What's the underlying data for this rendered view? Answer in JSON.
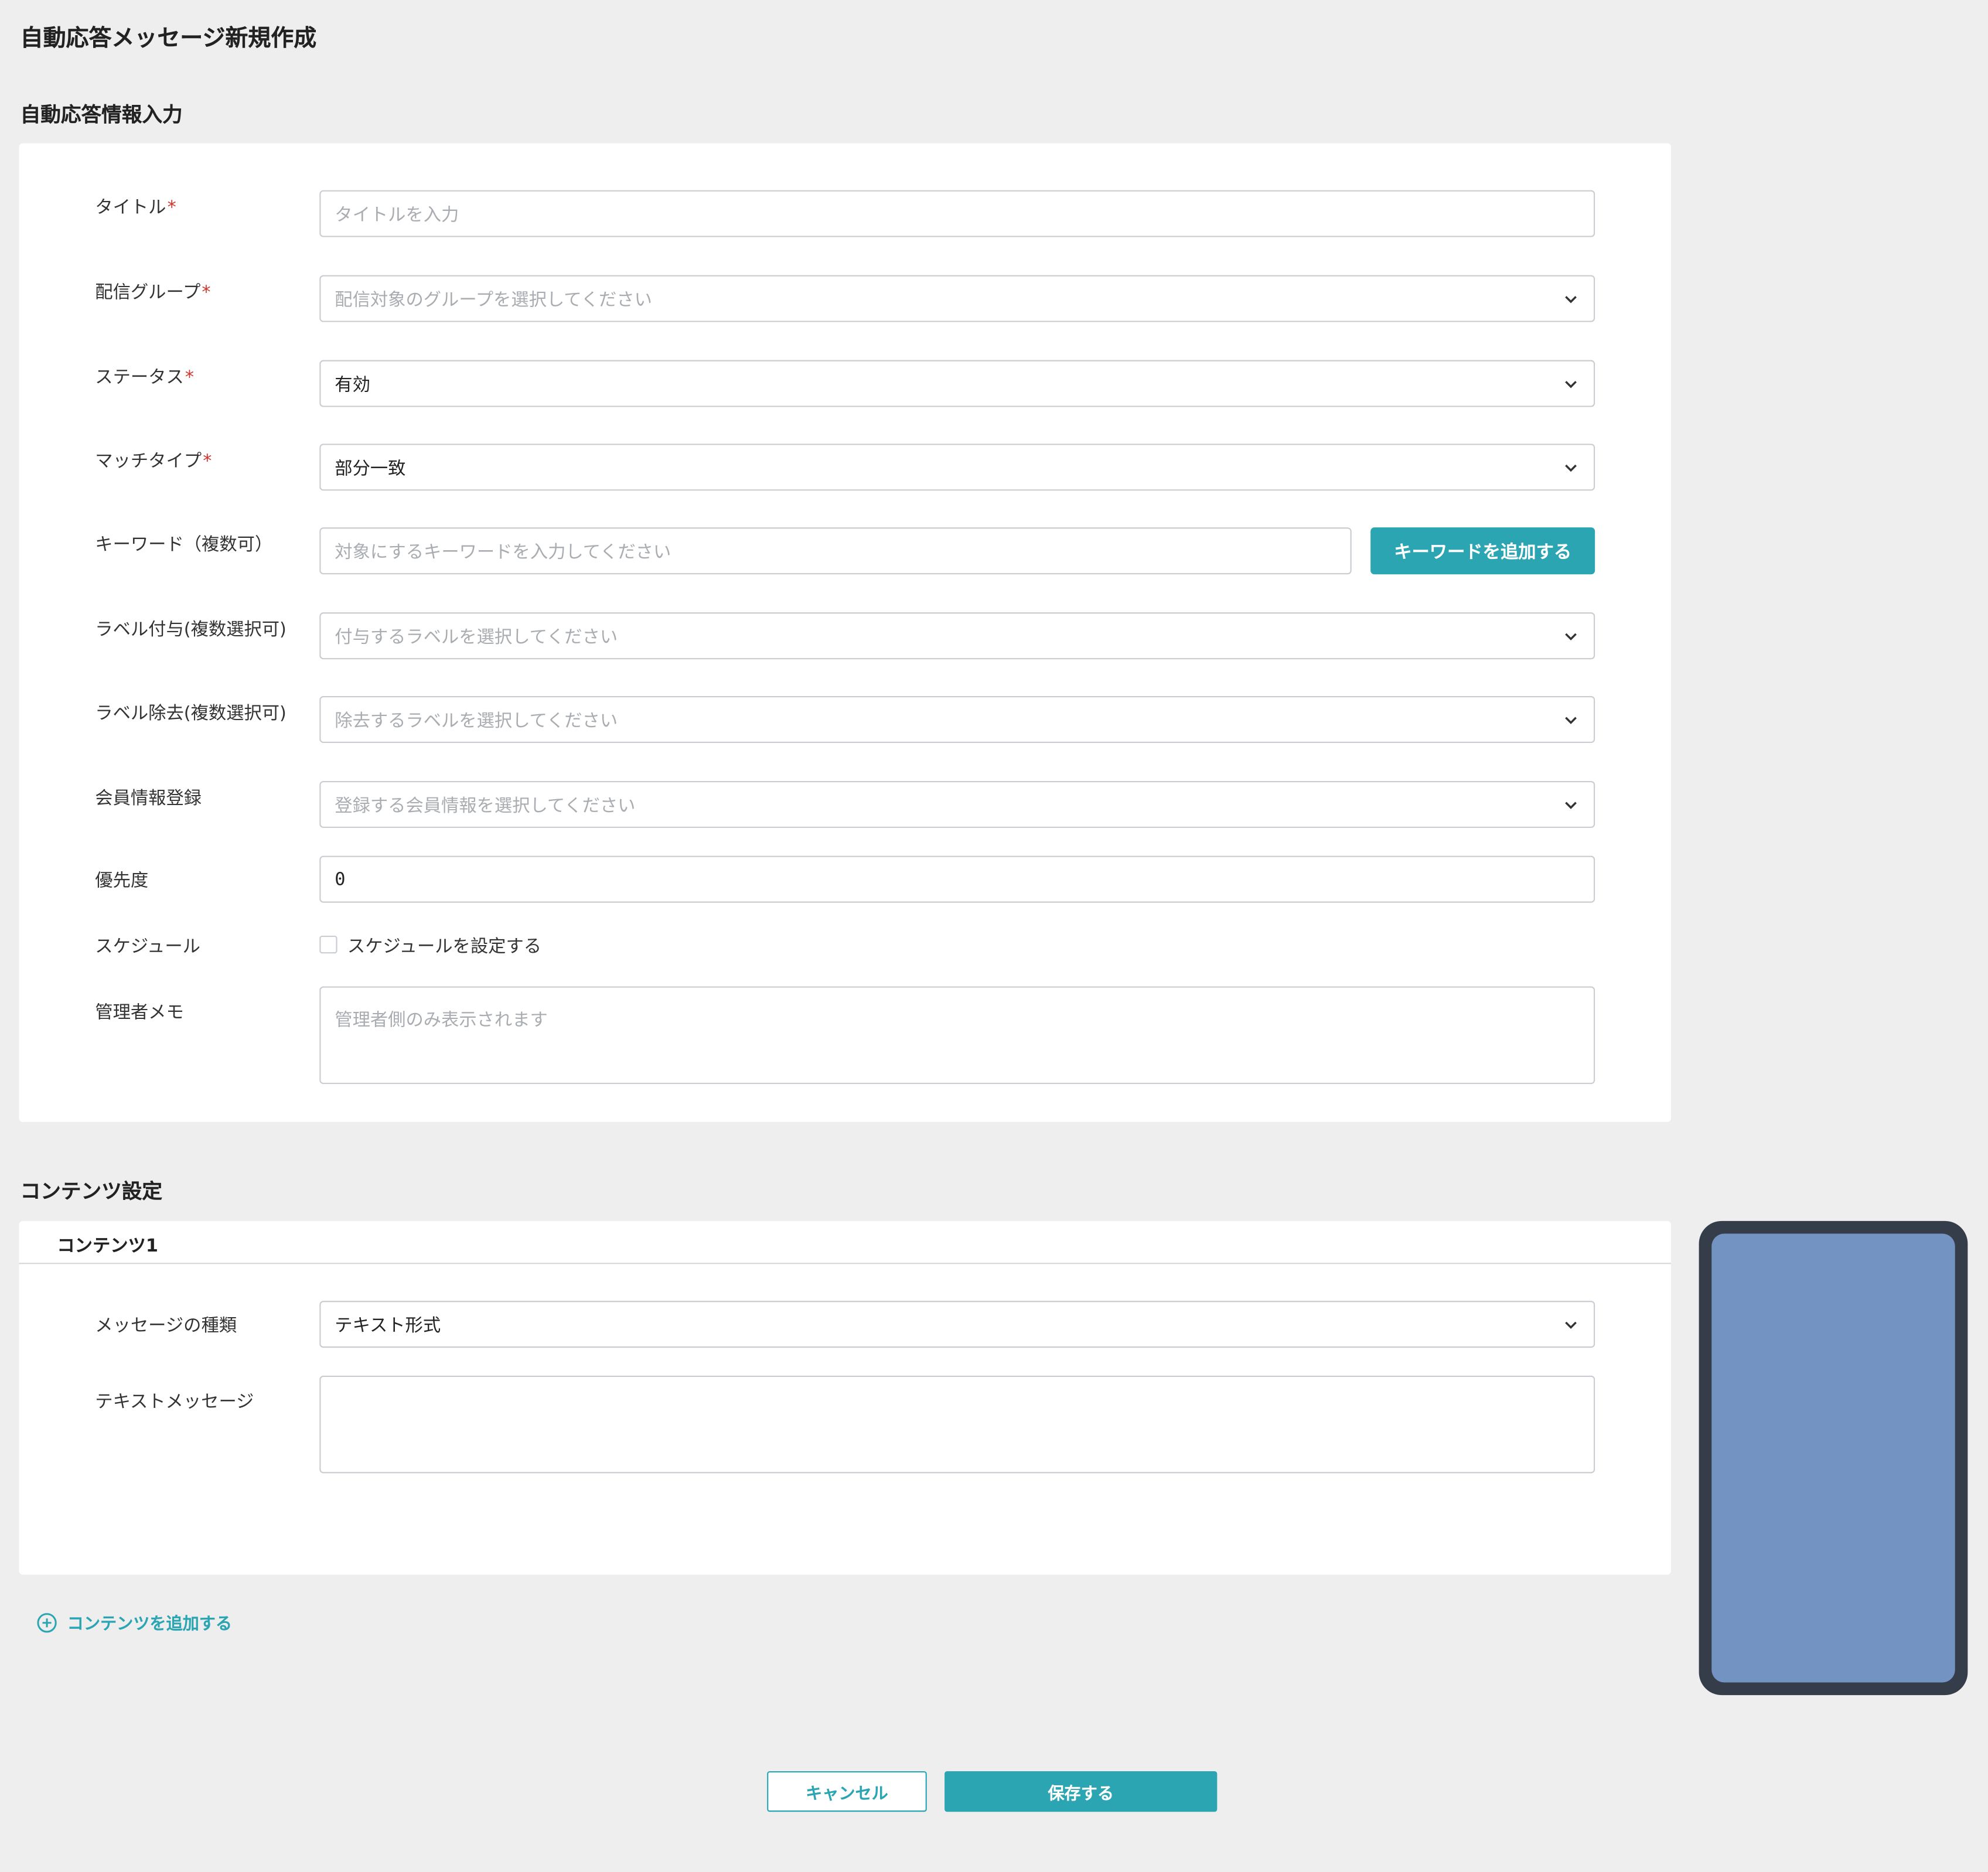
{
  "page": {
    "title": "自動応答メッセージ新規作成"
  },
  "info_section": {
    "title": "自動応答情報入力",
    "fields": {
      "title": {
        "label": "タイトル",
        "required": "*",
        "placeholder": "タイトルを入力"
      },
      "group": {
        "label": "配信グループ",
        "required": "*",
        "placeholder": "配信対象のグループを選択してください"
      },
      "status": {
        "label": "ステータス",
        "required": "*",
        "value": "有効"
      },
      "match_type": {
        "label": "マッチタイプ",
        "required": "*",
        "value": "部分一致"
      },
      "keyword": {
        "label": "キーワード（複数可）",
        "placeholder": "対象にするキーワードを入力してください",
        "button": "キーワードを追加する"
      },
      "label_add": {
        "label": "ラベル付与(複数選択可)",
        "placeholder": "付与するラベルを選択してください"
      },
      "label_remove": {
        "label": "ラベル除去(複数選択可)",
        "placeholder": "除去するラベルを選択してください"
      },
      "member_info": {
        "label": "会員情報登録",
        "placeholder": "登録する会員情報を選択してください"
      },
      "priority": {
        "label": "優先度",
        "value": "0"
      },
      "schedule": {
        "label": "スケジュール",
        "checkbox_label": "スケジュールを設定する"
      },
      "memo": {
        "label": "管理者メモ",
        "placeholder": "管理者側のみ表示されます"
      }
    }
  },
  "content_section": {
    "title": "コンテンツ設定",
    "contents": [
      {
        "header": "コンテンツ1",
        "message_type": {
          "label": "メッセージの種類",
          "value": "テキスト形式"
        },
        "text_message": {
          "label": "テキストメッセージ",
          "value": ""
        }
      }
    ],
    "add_button": "コンテンツを追加する"
  },
  "footer": {
    "cancel": "キャンセル",
    "save": "保存する"
  },
  "colors": {
    "accent": "#2ca5b3",
    "required": "#d0342c",
    "background": "#eeeeee",
    "phone_frame": "#353c4a",
    "phone_screen": "#7394c2"
  }
}
